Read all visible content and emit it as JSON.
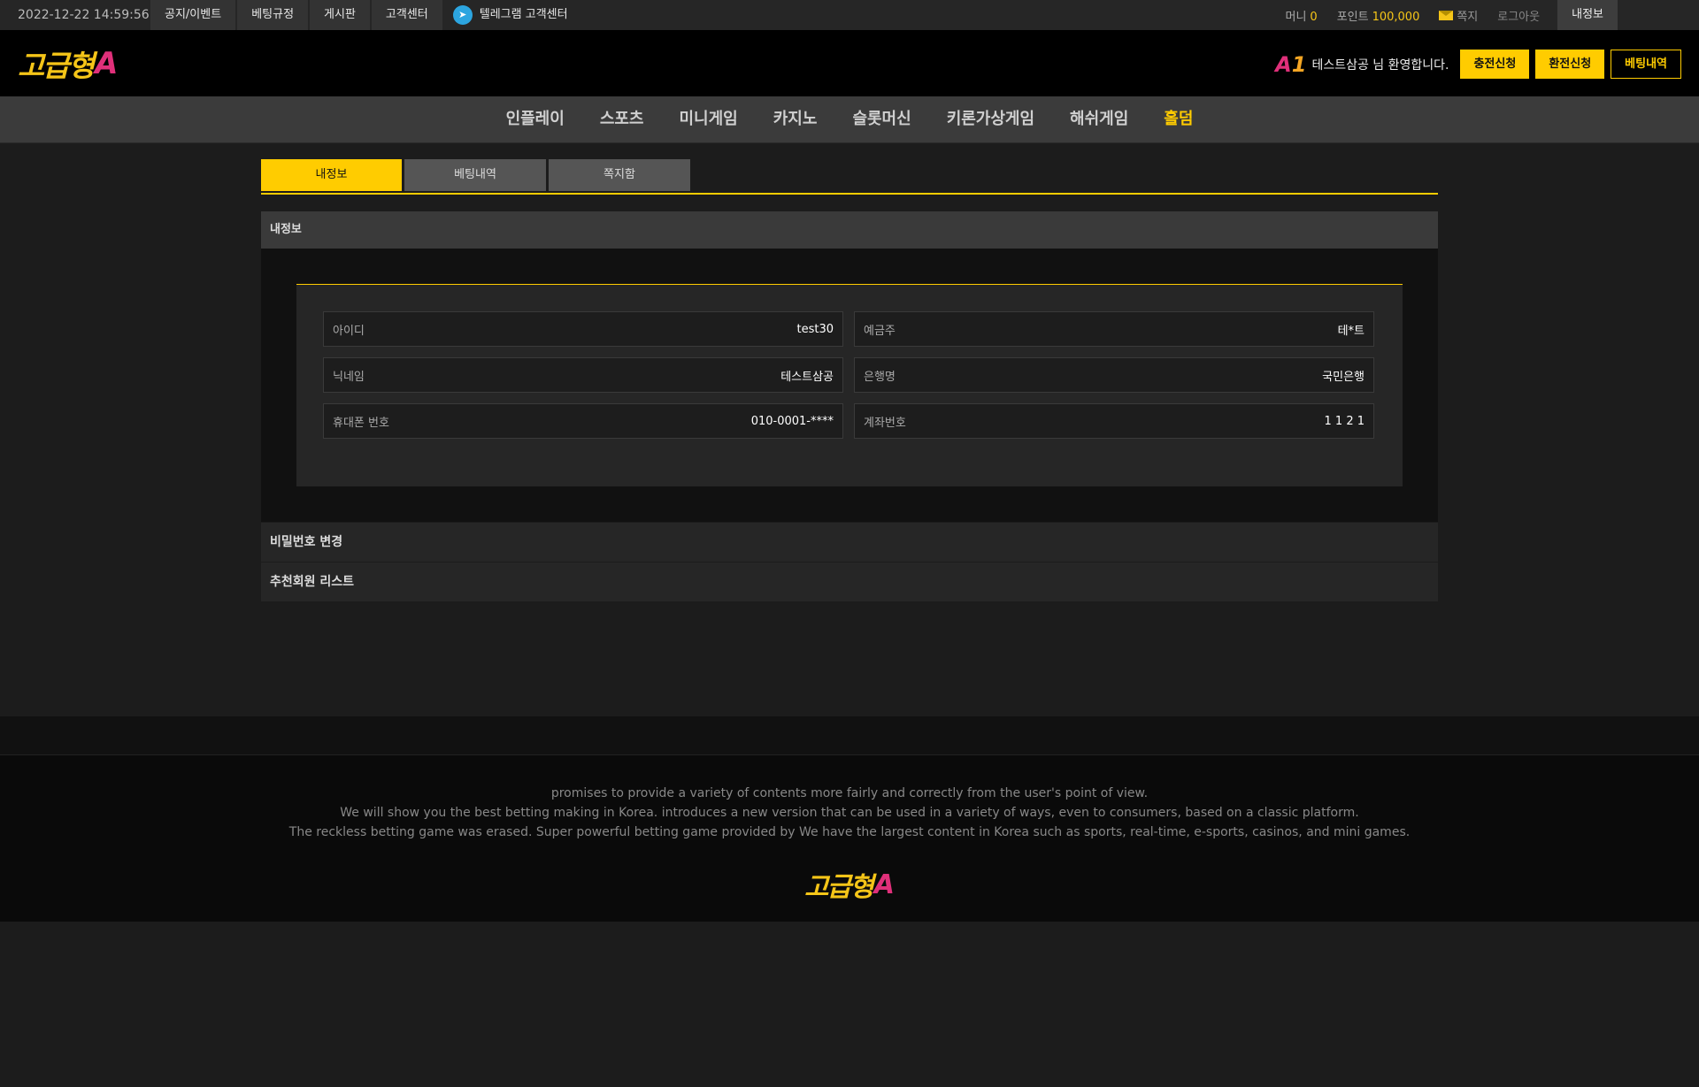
{
  "topbar": {
    "datetime": "2022-12-22 14:59:56",
    "nav": [
      "공지/이벤트",
      "베팅규정",
      "게시판",
      "고객센터"
    ],
    "telegram_label": "텔레그램 고객센터",
    "money_label": "머니",
    "money_value": "0",
    "point_label": "포인트",
    "point_value": "100,000",
    "message_label": "쪽지",
    "logout_label": "로그아웃",
    "myinfo_label": "내정보"
  },
  "header": {
    "logo_text": "고급형",
    "logo_accent": "A",
    "badge_a": "A",
    "badge_1": "1",
    "welcome": "테스트삼공 님 환영합니다.",
    "deposit_button": "충전신청",
    "withdraw_button": "환전신청",
    "betting_history_button": "베팅내역"
  },
  "mainnav": {
    "items": [
      "인플레이",
      "스포츠",
      "미니게임",
      "카지노",
      "슬롯머신",
      "키론가상게임",
      "해쉬게임",
      "홀덤"
    ],
    "highlight_color": "#ffcc00"
  },
  "tabs": [
    "내정보",
    "베팅내역",
    "쪽지함"
  ],
  "section": {
    "title": "내정보",
    "fields": [
      {
        "label": "아이디",
        "value": "test30"
      },
      {
        "label": "예금주",
        "value": "테*트"
      },
      {
        "label": "닉네임",
        "value": "테스트삼공"
      },
      {
        "label": "은행명",
        "value": "국민은행"
      },
      {
        "label": "휴대폰 번호",
        "value": "010-0001-****"
      },
      {
        "label": "계좌번호",
        "value": "1 1 2 1"
      }
    ]
  },
  "accordions": [
    "비밀번호 변경",
    "추천회원 리스트"
  ],
  "footer": {
    "lines": [
      "promises to provide a variety of contents more fairly and correctly from the user's point of view.",
      "We will show you the best betting making in Korea. introduces a new version that can be used in a variety of ways, even to consumers, based on a classic platform.",
      "The reckless betting game was erased. Super powerful betting game provided by  We have the largest content in Korea such as sports, real-time, e-sports, casinos, and mini games."
    ],
    "logo_text": "고급형",
    "logo_accent": "A"
  },
  "colors": {
    "accent": "#ffcc00",
    "logo_pink": "#e0307a",
    "background": "#1c1c1c"
  }
}
